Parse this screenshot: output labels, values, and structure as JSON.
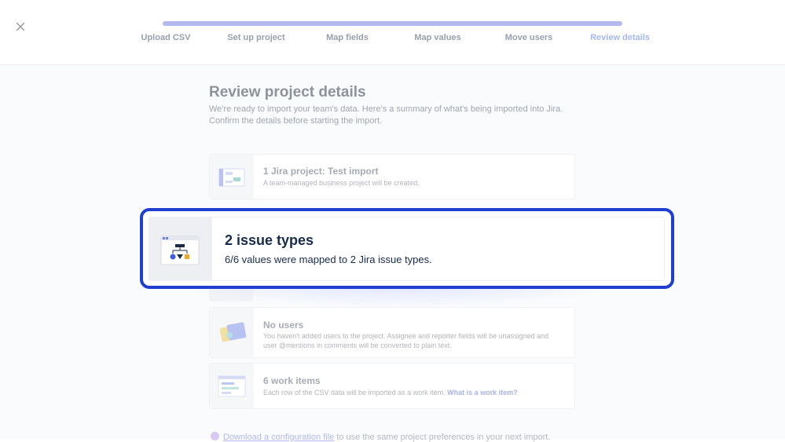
{
  "progress": {
    "steps_completed_fraction": 1.0
  },
  "steps": [
    {
      "label": "Upload CSV"
    },
    {
      "label": "Set up project"
    },
    {
      "label": "Map fields"
    },
    {
      "label": "Map values"
    },
    {
      "label": "Move users"
    },
    {
      "label": "Review details"
    }
  ],
  "active_step": "Review details",
  "header": {
    "title": "Review project details",
    "intro": "We're ready to import your team's data. Here's a summary of what's being imported into Jira. Confirm the details before starting the import."
  },
  "cards": {
    "project": {
      "title": "1 Jira project: Test import",
      "desc": "A team-managed business project will be created."
    },
    "issue_types": {
      "title": "2 issue types",
      "desc": "6/6 values were mapped to 2 Jira issue types."
    },
    "users": {
      "title": "No users",
      "desc": "You haven't added users to the project. Assignee and reporter fields will be unassigned and user @mentions in comments will be converted to plain text."
    },
    "work_items": {
      "title": "6 work items",
      "desc": "Each row of the CSV data will be imported as a work item.",
      "link": "What is a work item?"
    }
  },
  "footnote": {
    "link": "Download a configuration file",
    "text": " to use the same project preferences in your next import."
  },
  "colors": {
    "highlight_border": "#1f3fd0",
    "progress_fill": "#b3b9f0",
    "active_step": "#a4b8f4"
  }
}
